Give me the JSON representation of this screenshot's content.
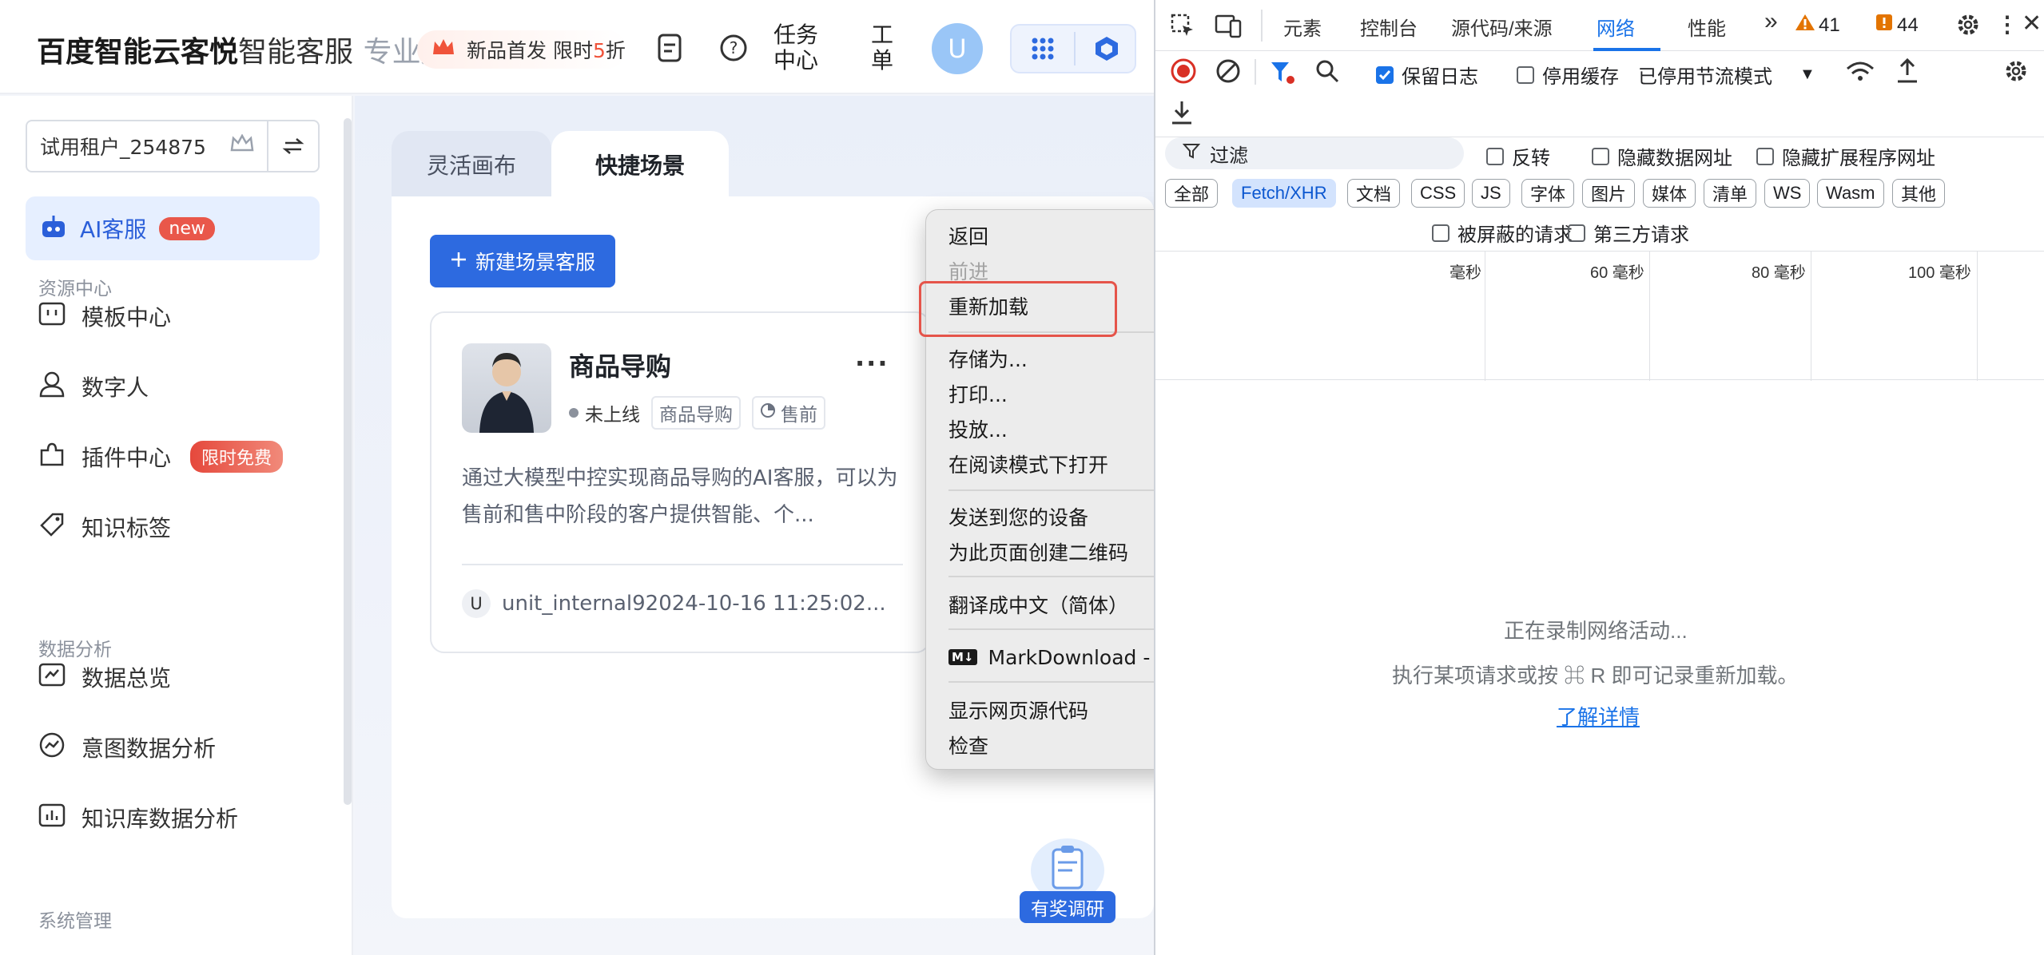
{
  "header": {
    "brand": "百度智能云客悦",
    "brand_sub": "智能客服",
    "edition": "专业版",
    "promo_text": "新品首发 限时",
    "promo_highlight": "5",
    "promo_suffix": "折",
    "task_center": "任务中心",
    "ticket": "工单",
    "avatar_letter": "U"
  },
  "sidebar": {
    "tenant": "试用租户_254875",
    "active_item": {
      "label": "AI客服",
      "badge": "new"
    },
    "sections": [
      {
        "title": "资源中心"
      },
      {
        "title": "数据分析"
      },
      {
        "title": "系统管理"
      }
    ],
    "items": [
      {
        "label": "模板中心",
        "icon": "template-icon"
      },
      {
        "label": "数字人",
        "icon": "person-icon"
      },
      {
        "label": "插件中心",
        "icon": "puzzle-icon",
        "badge": "限时免费"
      },
      {
        "label": "知识标签",
        "icon": "tag-icon"
      },
      {
        "label": "数据总览",
        "icon": "chart-icon"
      },
      {
        "label": "意图数据分析",
        "icon": "trend-icon"
      },
      {
        "label": "知识库数据分析",
        "icon": "bar-chart-icon"
      }
    ]
  },
  "main": {
    "tabs": [
      {
        "label": "灵活画布"
      },
      {
        "label": "快捷场景"
      }
    ],
    "new_button": "新建场景客服",
    "card": {
      "title": "商品导购",
      "more": "···",
      "status": "未上线",
      "tag1": "商品导购",
      "tag2": "售前",
      "desc": "通过大模型中控实现商品导购的AI客服，可以为售前和售中阶段的客户提供智能、个...",
      "user_initial": "U",
      "footer": "unit_internal92024-10-16 11:25:02..."
    },
    "survey_label": "有奖调研"
  },
  "context_menu": {
    "items": [
      {
        "label": "返回",
        "disabled": false
      },
      {
        "label": "前进",
        "disabled": true
      },
      {
        "label": "重新加载",
        "disabled": false
      },
      {
        "label": "存储为...",
        "disabled": false
      },
      {
        "label": "打印...",
        "disabled": false
      },
      {
        "label": "投放...",
        "disabled": false
      },
      {
        "label": "在阅读模式下打开",
        "disabled": false
      },
      {
        "label": "发送到您的设备",
        "disabled": false
      },
      {
        "label": "为此页面创建二维码",
        "disabled": false
      },
      {
        "label": "翻译成中文（简体）",
        "disabled": false
      },
      {
        "label": "MarkDownload - Markdown Web Clipper",
        "disabled": false
      },
      {
        "label": "显示网页源代码",
        "disabled": false
      },
      {
        "label": "检查",
        "disabled": false
      }
    ],
    "extension_icon": "M↓",
    "submenu_arrow": "›"
  },
  "devtools": {
    "tabs": [
      "元素",
      "控制台",
      "源代码/来源",
      "网络",
      "性能"
    ],
    "active_tab": "网络",
    "more_tabs": "»",
    "warnings": "41",
    "errors": "44",
    "preserve_log": "保留日志",
    "disable_cache": "停用缓存",
    "throttle": "已停用节流模式",
    "filter_placeholder": "过滤",
    "invert": "反转",
    "hide_data_urls": "隐藏数据网址",
    "hide_ext_urls": "隐藏扩展程序网址",
    "type_chips": [
      "全部",
      "Fetch/XHR",
      "文档",
      "CSS",
      "JS",
      "字体",
      "图片",
      "媒体",
      "清单",
      "WS",
      "Wasm",
      "其他"
    ],
    "selected_chip": "Fetch/XHR",
    "blocked_requests": "被屏蔽的请求",
    "third_party": "第三方请求",
    "timeline_labels": [
      "毫秒",
      "60 毫秒",
      "80 毫秒",
      "100 毫秒"
    ],
    "recording_msg": "正在录制网络活动...",
    "hint_msg": "执行某项请求或按 ⌘ R 即可记录重新加载。",
    "learn_more": "了解详情",
    "colors": {
      "accent": "#1a73e8",
      "warning": "#e37400",
      "error": "#d93025",
      "record": "#d93025"
    }
  }
}
